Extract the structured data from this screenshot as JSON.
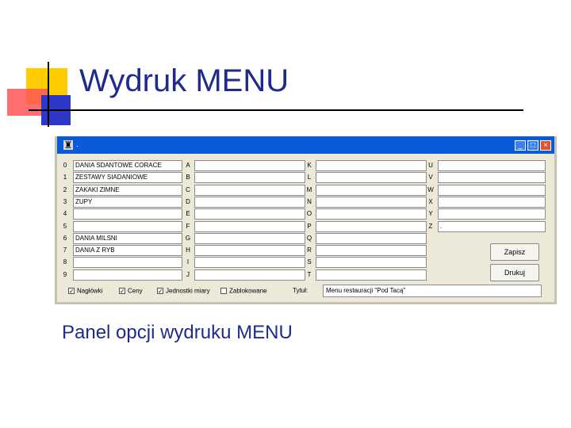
{
  "slide": {
    "title": "Wydruk MENU",
    "caption": "Panel opcji wydruku MENU"
  },
  "window": {
    "title": ".",
    "app_icon": "app-icon",
    "controls": {
      "minimize": "_",
      "maximize": "□",
      "close": "×"
    }
  },
  "columns": [
    {
      "labels": [
        "0",
        "1",
        "2",
        "3",
        "4",
        "5",
        "6",
        "7",
        "8",
        "9"
      ],
      "values": [
        "DANIA SDANTOWE CORACE",
        "ZESTAWY SIADANIOWE",
        "ZAKAKI ZIMNE",
        "ZUPY",
        "",
        "",
        "DANIA MILSNI",
        "DANIA Z RYB",
        "",
        ""
      ]
    },
    {
      "labels": [
        "A",
        "B",
        "C",
        "D",
        "E",
        "F",
        "G",
        "H",
        "I",
        "J"
      ],
      "values": [
        "",
        "",
        "",
        "",
        "",
        "",
        "",
        "",
        "",
        ""
      ]
    },
    {
      "labels": [
        "K",
        "L",
        "M",
        "N",
        "O",
        "P",
        "Q",
        "R",
        "S",
        "T"
      ],
      "values": [
        "",
        "",
        "",
        "",
        "",
        "",
        "",
        "",
        "",
        ""
      ]
    },
    {
      "labels": [
        "U",
        "V",
        "W",
        "X",
        "Y",
        "Z"
      ],
      "values": [
        "",
        "",
        "",
        "",
        "",
        "."
      ]
    }
  ],
  "buttons": {
    "save": "Zapisz",
    "print": "Drukuj"
  },
  "options": [
    {
      "label": "Nagłówki",
      "checked": true
    },
    {
      "label": "Ceny",
      "checked": true
    },
    {
      "label": "Jednostki miary",
      "checked": true
    },
    {
      "label": "Zablokowane",
      "checked": false
    }
  ],
  "print_title": {
    "label": "Tytuł:",
    "value": "Menu restauracji \"Pod Tacą\""
  }
}
